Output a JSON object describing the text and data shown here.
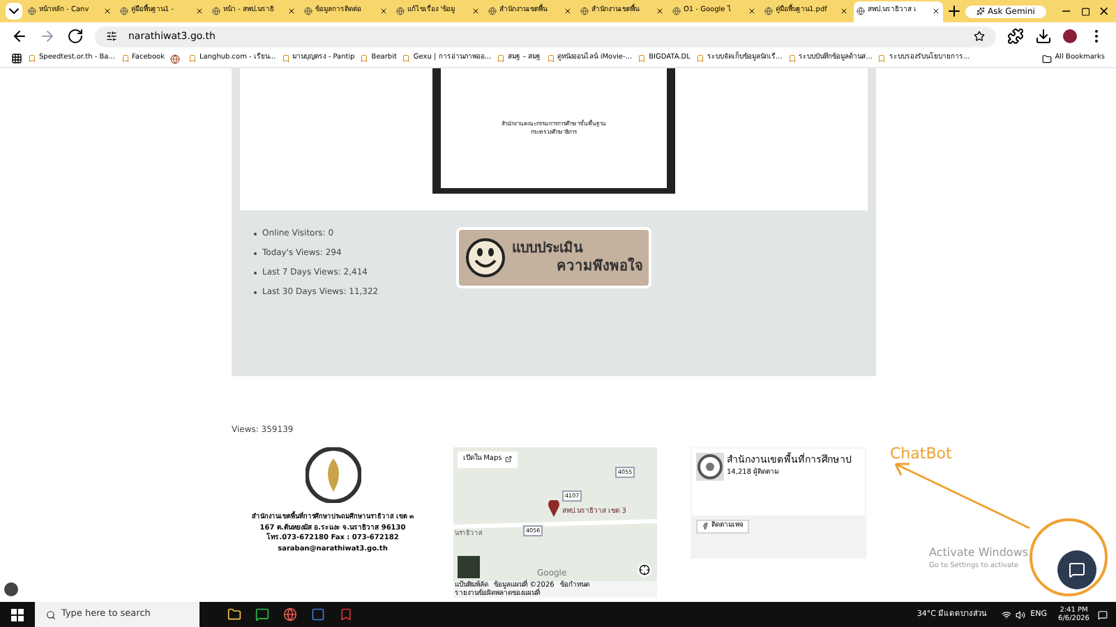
{
  "tabs": [
    {
      "title": "หน้าหลัก - Canv",
      "selected": false
    },
    {
      "title": "คู่มือพื้นฐาน1 - ",
      "selected": false
    },
    {
      "title": "หน้า - สพป.นราธิ",
      "selected": false
    },
    {
      "title": "ข้อมูลการติดต่อ",
      "selected": false
    },
    {
      "title": "แก้ไขเรื่อง 'ข้อมู",
      "selected": false
    },
    {
      "title": "สำนักงานเขตพื้น",
      "selected": false
    },
    {
      "title": "สำนักงานเขตพื้น",
      "selected": false
    },
    {
      "title": "O1 - Google ไ",
      "selected": false
    },
    {
      "title": "คู่มือพื้นฐาน1.pdf",
      "selected": false
    },
    {
      "title": "สพป.นราธิวาส เ",
      "selected": true
    }
  ],
  "ask_gemini": "Ask Gemini",
  "address": "narathiwat3.go.th",
  "bookmarks": [
    "Speedtest.or.th - Ba...",
    "Facebook",
    "Langhub.com - เรียน...",
    "มานบุญตรง - Pantip",
    "Bearbit",
    "Gexu | การอ่านภาพออ...",
    "สมฐ – สมฐ",
    "ดูหนังออนไลน์ iMovie-...",
    "BIGDATA.DL",
    "ระบบจัดเก็บข้อมูลนักเรี...",
    "ระบบบันทึกข้อมูลด้านส...",
    "ระบบรองรับนโยบายการ..."
  ],
  "all_bookmarks": "All Bookmarks",
  "document": {
    "lines": [
      "สำนักงานคณะกรรมการการศึกษาขั้นพื้นฐาน",
      "กระทรวงศึกษาธิการ"
    ]
  },
  "stats": [
    "Online Visitors: 0",
    "Today's Views: 294",
    "Last 7 Days Views: 2,414",
    "Last 30 Days Views: 11,322"
  ],
  "survey_banner": {
    "line_1": "แบบประเมิน",
    "line_2": "ความพึงพอใจ"
  },
  "views": "Views: 359139",
  "contact": [
    "สำนักงานเขตพื้นที่การศึกษาประถมศึกษานราธิวาส เขต ๓",
    "167 ต.ตันหยงมัส อ.ระแงะ จ.นราธิวาส 96130",
    "โทร.073-672180 Fax : 073-672182",
    "saraban@narathiwat3.go.th"
  ],
  "map": {
    "open_link": "เปิดใน Maps",
    "pin_label": "สพป.นราธิวาส เขต 3",
    "roads": [
      "4055",
      "4107",
      "4056"
    ],
    "town": "นราธิวาส",
    "brand": "Google",
    "footer": [
      "แป้นพิมพ์ลัด",
      "ข้อมูลแผนที่ ©2026",
      "ข้อกำหนด",
      "รายงานข้อผิดพลาดของแผนที่"
    ]
  },
  "facebook": {
    "page": "สำนักงานเขตพื้นที่การศึกษาป",
    "followers": "14,218 ผู้ติดตาม",
    "follow": "ติดตามเพจ"
  },
  "annotation": "ChatBot",
  "activate": {
    "title": "Activate Windows",
    "subtitle": "Go to Settings to activate"
  },
  "taskbar": {
    "search": "Type here to search",
    "weather": "34°C มีแดดบางส่วน",
    "lang": "ENG",
    "time": "2:41 PM",
    "date": "6/6/2026"
  }
}
